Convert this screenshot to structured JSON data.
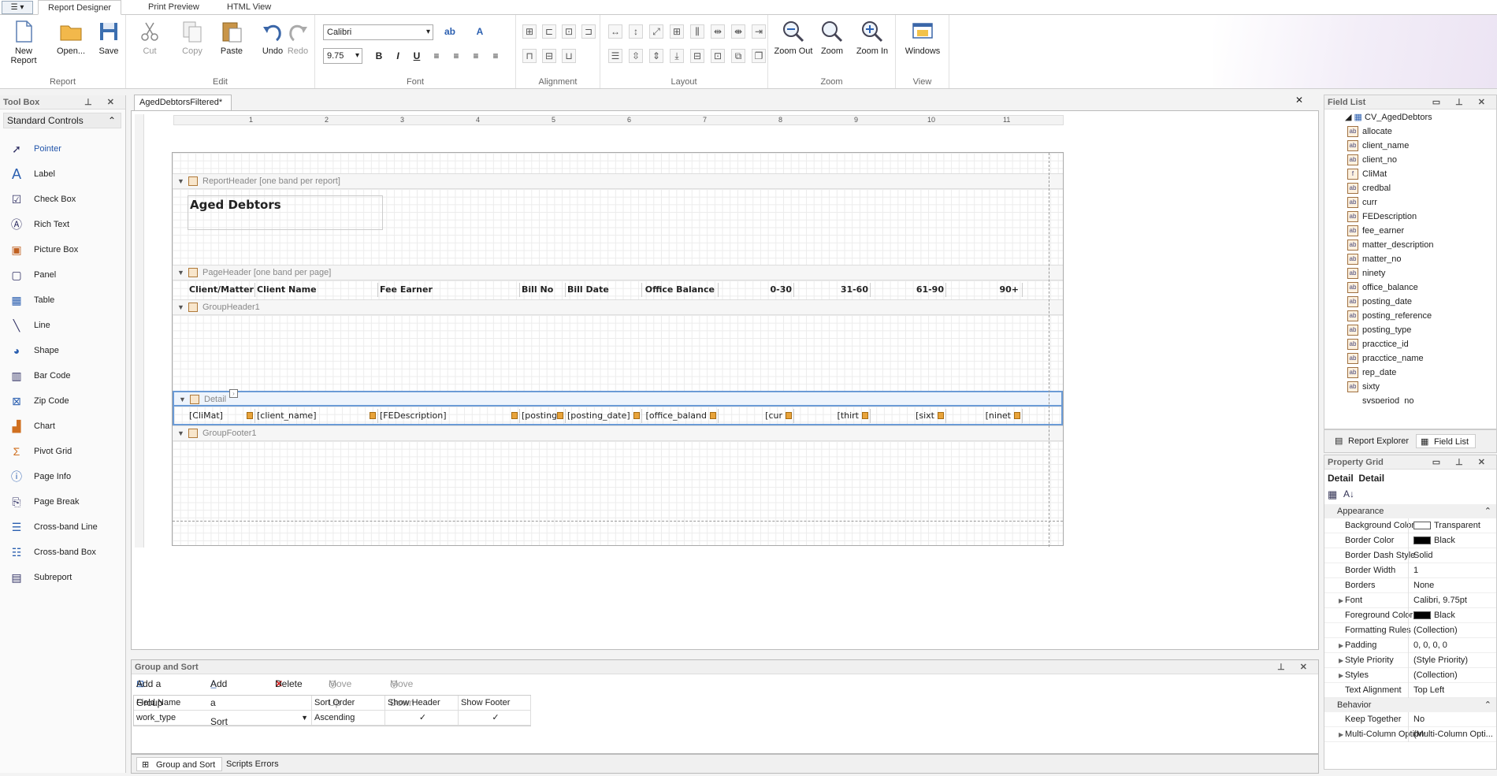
{
  "ribbon": {
    "tabs": [
      "Report Designer",
      "Print Preview",
      "HTML View"
    ],
    "app_menu": "☰ ▾",
    "groups": {
      "report": "Report",
      "edit": "Edit",
      "font": "Font",
      "alignment": "Alignment",
      "layout": "Layout",
      "zoom": "Zoom",
      "view": "View"
    },
    "buttons": {
      "new_report": "New Report",
      "open": "Open...",
      "save": "Save",
      "cut": "Cut",
      "copy": "Copy",
      "paste": "Paste",
      "undo": "Undo",
      "redo": "Redo",
      "zoom_out": "Zoom Out",
      "zoom": "Zoom",
      "zoom_in": "Zoom In",
      "windows": "Windows"
    },
    "font_name": "Calibri",
    "font_size": "9.75",
    "bold": "B",
    "italic": "I",
    "underline": "U"
  },
  "toolbox": {
    "title": "Tool Box",
    "category": "Standard Controls",
    "items": [
      "Pointer",
      "Label",
      "Check Box",
      "Rich Text",
      "Picture Box",
      "Panel",
      "Table",
      "Line",
      "Shape",
      "Bar Code",
      "Zip Code",
      "Chart",
      "Pivot Grid",
      "Page Info",
      "Page Break",
      "Cross-band Line",
      "Cross-band Box",
      "Subreport"
    ]
  },
  "designer": {
    "tab": "AgedDebtorsFiltered*",
    "ruler": [
      "1",
      "2",
      "3",
      "4",
      "5",
      "6",
      "7",
      "8",
      "9",
      "10",
      "11"
    ],
    "bands": {
      "report_header": "ReportHeader [one band per report]",
      "page_header": "PageHeader [one band per page]",
      "group_header": "GroupHeader1",
      "detail": "Detail",
      "group_footer": "GroupFooter1"
    },
    "report_title": "Aged Debtors",
    "headers": [
      "Client/Matter No",
      "Client Name",
      "Fee Earner",
      "Bill No",
      "Bill Date",
      "Office Balance",
      "0-30",
      "31-60",
      "61-90",
      "90+"
    ],
    "detail": [
      "[CliMat]",
      "[client_name]",
      "[FEDescription]",
      "[posting",
      "[posting_date]",
      "[office_baland",
      "[cur",
      "[thirt",
      "[sixt",
      "[ninet"
    ]
  },
  "group_sort": {
    "title": "Group and Sort",
    "tools": {
      "add_group": "Add a Group",
      "add_sort": "Add a Sort",
      "delete": "Delete",
      "move_up": "Move Up",
      "move_down": "Move Down"
    },
    "columns": [
      "Field Name",
      "Sort Order",
      "Show Header",
      "Show Footer"
    ],
    "row": {
      "field": "work_type",
      "order": "Ascending",
      "show_header": "✓",
      "show_footer": "✓"
    },
    "bottom_tabs": [
      "Group and Sort",
      "Scripts Errors"
    ]
  },
  "field_list": {
    "title": "Field List",
    "root": "CV_AgedDebtors",
    "fields": [
      "allocate",
      "client_name",
      "client_no",
      "CliMat",
      "credbal",
      "curr",
      "FEDescription",
      "fee_earner",
      "matter_description",
      "matter_no",
      "ninety",
      "office_balance",
      "posting_date",
      "posting_reference",
      "posting_type",
      "pracctice_id",
      "pracctice_name",
      "rep_date",
      "sixty",
      "sysperiod_no"
    ],
    "tabs": [
      "Report Explorer",
      "Field List"
    ]
  },
  "property_grid": {
    "title": "Property Grid",
    "selected": "Detail",
    "selected_type": "Detail",
    "categories": {
      "appearance": "Appearance",
      "behavior": "Behavior"
    },
    "rows": [
      {
        "name": "Background Color",
        "value": "Transparent",
        "swatch": "#ffffff"
      },
      {
        "name": "Border Color",
        "value": "Black",
        "swatch": "#000000"
      },
      {
        "name": "Border Dash Style",
        "value": "Solid"
      },
      {
        "name": "Border Width",
        "value": "1"
      },
      {
        "name": "Borders",
        "value": "None"
      },
      {
        "name": "Font",
        "value": "Calibri, 9.75pt"
      },
      {
        "name": "Foreground Color",
        "value": "Black",
        "swatch": "#000000"
      },
      {
        "name": "Formatting Rules",
        "value": "(Collection)"
      },
      {
        "name": "Padding",
        "value": "0, 0, 0, 0"
      },
      {
        "name": "Style Priority",
        "value": "(Style Priority)"
      },
      {
        "name": "Styles",
        "value": "(Collection)"
      },
      {
        "name": "Text Alignment",
        "value": "Top Left"
      }
    ],
    "behavior_rows": [
      {
        "name": "Keep Together",
        "value": "No"
      },
      {
        "name": "Multi-Column Options",
        "value": "(Multi-Column Opti..."
      }
    ]
  }
}
